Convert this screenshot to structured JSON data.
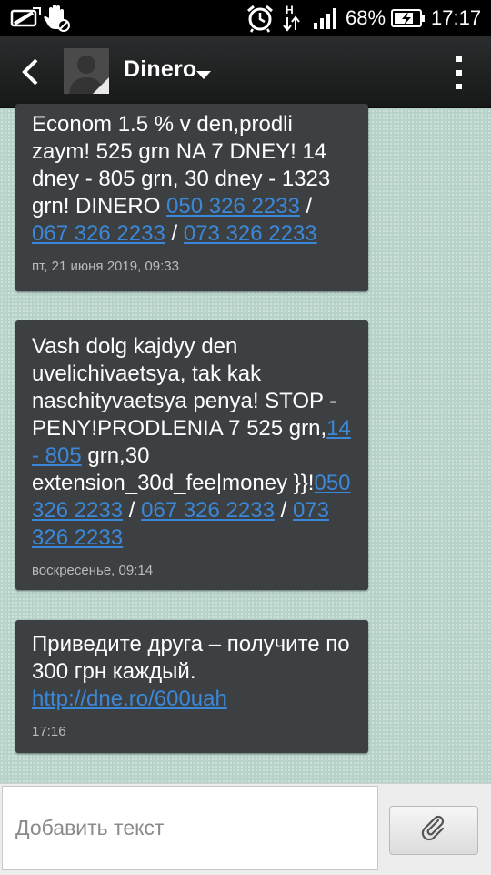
{
  "status_bar": {
    "battery_percent": "68%",
    "time": "17:17",
    "network_type": "H",
    "icons": [
      "sd-card-icon",
      "hand-blocked-icon",
      "alarm-icon",
      "network-arrows-icon",
      "signal-icon",
      "battery-charging-icon"
    ]
  },
  "header": {
    "contact_name": "Dinero",
    "icons": [
      "back-arrow-icon",
      "avatar",
      "dropdown-caret-icon",
      "overflow-menu-icon"
    ]
  },
  "messages": [
    {
      "segments": [
        {
          "t": "Econom 1.5 % v den,prodli zaym! 525 grn NA 7 DNEY! 14 dney - 805 grn, 30 dney - 1323 grn! DINERO "
        },
        {
          "t": "050 326 2233",
          "link": true
        },
        {
          "t": " / "
        },
        {
          "t": "067 326 2233",
          "link": true
        },
        {
          "t": " / "
        },
        {
          "t": "073 326 2233",
          "link": true
        }
      ],
      "timestamp": "пт, 21 июня 2019, 09:33"
    },
    {
      "segments": [
        {
          "t": "Vash dolg kajdyy den uvelichivaetsya, tak kak naschityvaetsya penya! STOP -PENY!PRODLENIA 7  525 grn,"
        },
        {
          "t": "14 - 805",
          "link": true
        },
        {
          "t": " grn,30 extension_30d_fee|money }}!"
        },
        {
          "t": "050 326 2233",
          "link": true
        },
        {
          "t": " / "
        },
        {
          "t": "067 326 2233",
          "link": true
        },
        {
          "t": " / "
        },
        {
          "t": "073 326 2233",
          "link": true
        }
      ],
      "timestamp": "воскресенье, 09:14"
    },
    {
      "segments": [
        {
          "t": "Приведите друга – получите по 300 грн каждый. "
        },
        {
          "t": "http://dne.ro/600uah",
          "link": true
        }
      ],
      "timestamp": "17:16"
    }
  ],
  "compose": {
    "placeholder": "Добавить текст",
    "attach_icon": "paperclip-icon"
  },
  "colors": {
    "background": "#b7d3c9",
    "bubble": "#3d4042",
    "link": "#3b87d8",
    "action_bar": "#1f2021"
  }
}
